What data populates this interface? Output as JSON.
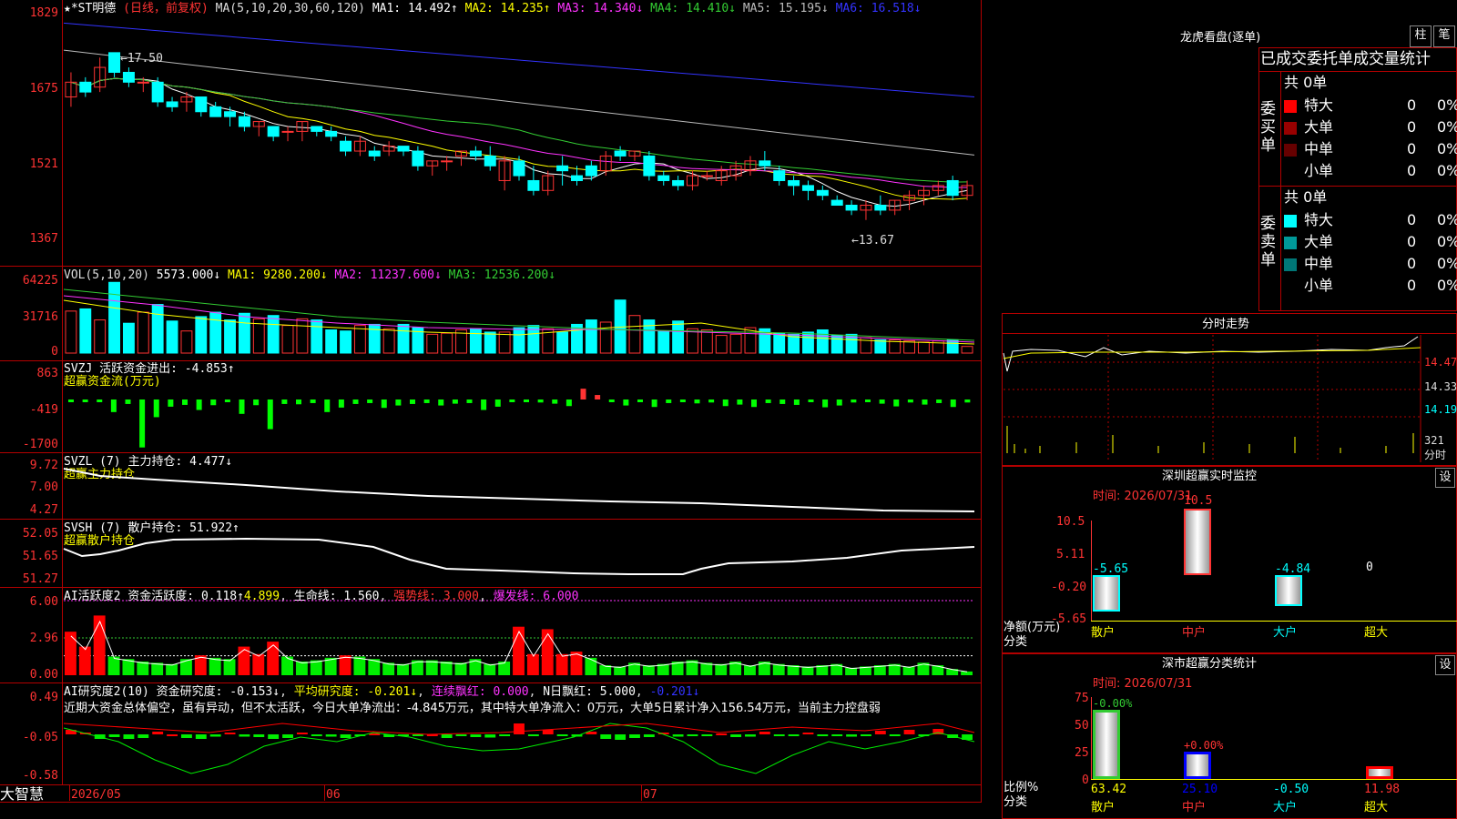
{
  "main": {
    "stock_name": "★*ST明德",
    "period": "(日线，前复权)",
    "ma_label": "MA(5,10,20,30,60,120)",
    "ma_values": [
      {
        "text": "MA1: 14.492↑",
        "color": "#ffffff"
      },
      {
        "text": "MA2: 14.235↑",
        "color": "#ffff00"
      },
      {
        "text": "MA3: 14.340↓",
        "color": "#ff33ff"
      },
      {
        "text": "MA4: 14.410↓",
        "color": "#33cc33"
      },
      {
        "text": "MA5: 15.195↓",
        "color": "#bbbbbb"
      },
      {
        "text": "MA6: 16.518↓",
        "color": "#3333ff"
      }
    ],
    "axis": [
      "1829",
      "1675",
      "1521",
      "1367"
    ],
    "high_mark": "17.50",
    "low_mark": "13.67"
  },
  "vol": {
    "header": "VOL(5,10,20)",
    "value": "5573.000↓",
    "ma": [
      {
        "text": "MA1: 9280.200↓",
        "color": "#ffff00"
      },
      {
        "text": "MA2: 11237.600↓",
        "color": "#ff33ff"
      },
      {
        "text": "MA3: 12536.200↓",
        "color": "#33cc33"
      }
    ],
    "axis": [
      "64225",
      "31716",
      "0"
    ]
  },
  "svzj": {
    "header": "SVZJ  活跃资金进出: -4.853↑",
    "sub": "超赢资金流(万元)",
    "axis": [
      "863",
      "-419",
      "-1700"
    ]
  },
  "svzl": {
    "header": "SVZL (7) 主力持仓: 4.477↓",
    "sub": "超赢主力持仓",
    "axis": [
      "9.72",
      "7.00",
      "4.27"
    ]
  },
  "svsh": {
    "header": "SVSH (7) 散户持仓: 51.922↑",
    "sub": "超赢散户持仓",
    "axis": [
      "52.05",
      "51.65",
      "51.27"
    ]
  },
  "ai1": {
    "header": "AI活跃度2 资金活跃度: 0.118↑",
    "v2": "4.899",
    "life": "生命线: 1.560",
    "strong": "强势线: 3.000",
    "burst": "爆发线: 6.000",
    "axis": [
      "6.00",
      "2.96",
      "0.00"
    ]
  },
  "ai2": {
    "header": "AI研究度2(10) 资金研究度: -0.153↓",
    "avg": "平均研究度: -0.201↓",
    "red": "连续飘红: 0.000",
    "nred": "N日飘红: 5.000",
    "last": "-0.201↓",
    "commentary": "近期大资金总体偏空，虽有异动，但不太活跃，今日大单净流出：-4.845万元，其中特大单净流入：0万元，大单5日累计净入156.54万元，当前主力控盘弱",
    "axis": [
      "0.49",
      "-0.05",
      "-0.58"
    ]
  },
  "bottom_bar": {
    "brand": "大智慧",
    "dates": [
      "2026/05",
      "06",
      "07"
    ]
  },
  "right": {
    "btn_zhu": "柱",
    "btn_bi": "笔",
    "lhb_title": "龙虎看盘(逐单)",
    "lhb_subtitle": "已成交委托单成交量统计",
    "buy_label": "委买单",
    "sell_label": "委卖单",
    "buy_total": "共 0单",
    "sell_total": "共 0单",
    "buy_rows": [
      {
        "name": "特大",
        "count": "0",
        "pct": "0%",
        "color": "#ff0000"
      },
      {
        "name": "大单",
        "count": "0",
        "pct": "0%",
        "color": "#990000"
      },
      {
        "name": "中单",
        "count": "0",
        "pct": "0%",
        "color": "#660000"
      },
      {
        "name": "小单",
        "count": "0",
        "pct": "0%",
        "color": ""
      }
    ],
    "sell_rows": [
      {
        "name": "特大",
        "count": "0",
        "pct": "0%",
        "color": "#00ffff"
      },
      {
        "name": "大单",
        "count": "0",
        "pct": "0%",
        "color": "#009999"
      },
      {
        "name": "中单",
        "count": "0",
        "pct": "0%",
        "color": "#007777"
      },
      {
        "name": "小单",
        "count": "0",
        "pct": "0%",
        "color": ""
      }
    ],
    "fs_title": "分时走势",
    "fs_axis": [
      "14.47",
      "14.33",
      "14.19"
    ],
    "fs_vol": "321",
    "fs_unit": "分时",
    "sz_title": "深圳超赢实时监控",
    "sz_time": "时间: 2026/07/31",
    "sz_axis": [
      "10.5",
      "5.11",
      "-0.20",
      "-5.65"
    ],
    "sz_unit": "净额(万元)",
    "sz_class": "分类",
    "sz_bars": [
      {
        "name": "散户",
        "value": "-5.65"
      },
      {
        "name": "中户",
        "value": "10.5"
      },
      {
        "name": "大户",
        "value": "-4.84"
      },
      {
        "name": "超大",
        "value": "0"
      }
    ],
    "fl_title": "深市超赢分类统计",
    "fl_time": "时间: 2026/07/31",
    "fl_axis": [
      "75",
      "50",
      "25",
      "0"
    ],
    "fl_ratio": "比例%",
    "fl_class": "分类",
    "fl_bars": [
      {
        "name": "散户",
        "top": "-0.00%",
        "value": "63.42",
        "pct": 63.42
      },
      {
        "name": "中户",
        "top": "+0.00%",
        "value": "25.10",
        "pct": 25.1
      },
      {
        "name": "大户",
        "top": "",
        "value": "-0.50",
        "pct": 0
      },
      {
        "name": "超大",
        "top": "",
        "value": "11.98",
        "pct": 11.98
      }
    ],
    "btn_set": "设"
  },
  "chart_data": [
    {
      "type": "candlestick",
      "name": "daily-kline",
      "ohlc": [
        [
          16.6,
          17.1,
          16.4,
          16.9
        ],
        [
          16.9,
          17.0,
          16.6,
          16.7
        ],
        [
          16.8,
          17.4,
          16.7,
          17.2
        ],
        [
          17.5,
          17.5,
          17.0,
          17.1
        ],
        [
          17.1,
          17.2,
          16.8,
          16.9
        ],
        [
          16.9,
          17.0,
          16.7,
          16.9
        ],
        [
          16.9,
          17.0,
          16.4,
          16.5
        ],
        [
          16.5,
          16.6,
          16.3,
          16.4
        ],
        [
          16.5,
          16.7,
          16.3,
          16.6
        ],
        [
          16.6,
          16.6,
          16.2,
          16.3
        ],
        [
          16.4,
          16.5,
          16.2,
          16.2
        ],
        [
          16.3,
          16.4,
          16.0,
          16.2
        ],
        [
          16.2,
          16.3,
          15.9,
          16.0
        ],
        [
          16.0,
          16.1,
          15.8,
          16.1
        ],
        [
          16.0,
          16.0,
          15.7,
          15.8
        ],
        [
          15.9,
          16.0,
          15.7,
          15.9
        ],
        [
          15.9,
          16.1,
          15.7,
          16.1
        ],
        [
          16.0,
          16.0,
          15.8,
          15.9
        ],
        [
          15.9,
          16.0,
          15.7,
          15.8
        ],
        [
          15.7,
          15.8,
          15.4,
          15.5
        ],
        [
          15.5,
          15.8,
          15.4,
          15.7
        ],
        [
          15.5,
          15.6,
          15.3,
          15.4
        ],
        [
          15.5,
          15.7,
          15.4,
          15.6
        ],
        [
          15.6,
          15.6,
          15.4,
          15.5
        ],
        [
          15.5,
          15.6,
          15.1,
          15.2
        ],
        [
          15.2,
          15.3,
          15.0,
          15.3
        ],
        [
          15.3,
          15.4,
          15.1,
          15.3
        ],
        [
          15.4,
          15.5,
          15.2,
          15.5
        ],
        [
          15.5,
          15.6,
          15.3,
          15.4
        ],
        [
          15.4,
          15.6,
          15.1,
          15.2
        ],
        [
          14.9,
          15.4,
          14.7,
          15.3
        ],
        [
          15.3,
          15.4,
          14.9,
          15.0
        ],
        [
          14.9,
          15.2,
          14.6,
          14.7
        ],
        [
          14.7,
          15.1,
          14.6,
          15.0
        ],
        [
          15.2,
          15.4,
          14.8,
          15.1
        ],
        [
          15.0,
          15.2,
          14.8,
          14.9
        ],
        [
          15.2,
          15.3,
          14.9,
          15.0
        ],
        [
          15.1,
          15.5,
          15.0,
          15.4
        ],
        [
          15.5,
          15.6,
          15.3,
          15.4
        ],
        [
          15.4,
          15.5,
          15.3,
          15.5
        ],
        [
          15.4,
          15.5,
          14.9,
          15.0
        ],
        [
          15.0,
          15.1,
          14.8,
          14.9
        ],
        [
          14.9,
          15.0,
          14.7,
          14.8
        ],
        [
          14.8,
          15.1,
          14.7,
          15.0
        ],
        [
          15.0,
          15.1,
          14.9,
          15.0
        ],
        [
          14.9,
          15.2,
          14.8,
          15.1
        ],
        [
          15.0,
          15.3,
          14.9,
          15.2
        ],
        [
          15.1,
          15.4,
          15.0,
          15.3
        ],
        [
          15.3,
          15.5,
          15.1,
          15.2
        ],
        [
          15.1,
          15.2,
          14.8,
          14.9
        ],
        [
          14.9,
          15.0,
          14.6,
          14.8
        ],
        [
          14.8,
          14.9,
          14.5,
          14.7
        ],
        [
          14.7,
          14.8,
          14.5,
          14.6
        ],
        [
          14.5,
          14.6,
          14.4,
          14.4
        ],
        [
          14.4,
          14.5,
          14.2,
          14.3
        ],
        [
          14.3,
          14.5,
          14.1,
          14.4
        ],
        [
          14.4,
          14.6,
          14.2,
          14.3
        ],
        [
          14.3,
          14.5,
          14.2,
          14.5
        ],
        [
          14.5,
          14.7,
          14.3,
          14.6
        ],
        [
          14.6,
          14.8,
          14.4,
          14.7
        ],
        [
          14.7,
          14.9,
          14.6,
          14.8
        ],
        [
          14.9,
          15.0,
          14.5,
          14.6
        ],
        [
          14.6,
          14.9,
          14.5,
          14.8
        ]
      ],
      "ylim": [
        13.67,
        18.29
      ],
      "high_label": "17.50",
      "low_label": "13.67"
    },
    {
      "type": "bar",
      "name": "volume",
      "values": [
        38000,
        40000,
        30000,
        64000,
        27000,
        37000,
        44000,
        29000,
        20000,
        33000,
        37000,
        30000,
        36000,
        31000,
        34000,
        25000,
        31000,
        30000,
        21000,
        20000,
        25000,
        26000,
        22000,
        26000,
        23000,
        17000,
        18000,
        21000,
        22000,
        19000,
        19000,
        23000,
        25000,
        22000,
        19000,
        26000,
        30000,
        28000,
        48000,
        34000,
        30000,
        20000,
        29000,
        22000,
        21000,
        16000,
        17000,
        23000,
        22000,
        18000,
        17000,
        19000,
        21000,
        16000,
        17000,
        14000,
        12000,
        12000,
        11000,
        10000,
        11000,
        12000,
        6000
      ],
      "ylim": [
        0,
        64225
      ]
    },
    {
      "type": "bar",
      "name": "svzj",
      "values": [
        -60,
        -80,
        -60,
        -420,
        -150,
        -1600,
        -590,
        -240,
        -180,
        -350,
        -190,
        -80,
        -480,
        -190,
        -990,
        -150,
        -160,
        -120,
        -420,
        -270,
        -150,
        -120,
        -280,
        -200,
        -150,
        -120,
        -200,
        -140,
        -120,
        -350,
        -240,
        -80,
        -60,
        -100,
        -140,
        -220,
        120,
        50,
        -30,
        -200,
        -90,
        -250,
        -120,
        -80,
        -130,
        -100,
        -220,
        -170,
        -250,
        -120,
        -150,
        -180,
        -60,
        -260,
        -200,
        -100,
        -80,
        -140,
        -230,
        -100,
        -170,
        -120,
        -250,
        -100
      ],
      "ylim": [
        -1700,
        863
      ]
    },
    {
      "type": "area",
      "name": "ai-activity",
      "values": [
        3.5,
        2.3,
        4.8,
        1.5,
        1.3,
        1.1,
        1.0,
        0.9,
        1.3,
        1.6,
        1.4,
        1.3,
        2.3,
        1.7,
        2.7,
        1.5,
        1.1,
        1.2,
        1.4,
        1.6,
        1.5,
        1.3,
        1.0,
        0.9,
        1.2,
        1.2,
        1.1,
        1.0,
        1.3,
        0.9,
        1.1,
        3.9,
        1.7,
        3.7,
        1.7,
        1.9,
        1.4,
        0.8,
        0.7,
        1.0,
        0.8,
        0.9,
        1.1,
        1.2,
        1.0,
        0.9,
        1.1,
        0.8,
        1.1,
        0.9,
        0.8,
        0.7,
        0.8,
        0.9,
        0.6,
        0.7,
        0.8,
        0.9,
        0.7,
        1.0,
        0.8,
        0.5,
        0.3
      ],
      "ylim": [
        0,
        6.0
      ],
      "lines": [
        1.56,
        3.0,
        6.0
      ]
    },
    {
      "type": "bar",
      "name": "ai-research",
      "values": [
        0.05,
        0.02,
        -0.1,
        -0.06,
        -0.1,
        -0.08,
        0.03,
        0.0,
        -0.08,
        -0.1,
        -0.05,
        0.02,
        -0.05,
        -0.06,
        -0.1,
        -0.08,
        0.02,
        -0.03,
        -0.05,
        -0.08,
        -0.04,
        0.01,
        -0.06,
        -0.02,
        -0.04,
        0.0,
        -0.08,
        -0.03,
        -0.06,
        -0.07,
        -0.04,
        0.12,
        -0.03,
        0.05,
        -0.02,
        -0.05,
        0.03,
        -0.1,
        -0.12,
        -0.08,
        -0.06,
        0.02,
        -0.05,
        -0.03,
        -0.04,
        0.01,
        -0.06,
        -0.05,
        0.03,
        -0.04,
        -0.03,
        0.02,
        -0.04,
        -0.03,
        -0.05,
        -0.02,
        0.04,
        -0.03,
        0.05,
        -0.03,
        0.06,
        -0.08,
        -0.12
      ],
      "ylim": [
        -0.58,
        0.49
      ]
    }
  ]
}
